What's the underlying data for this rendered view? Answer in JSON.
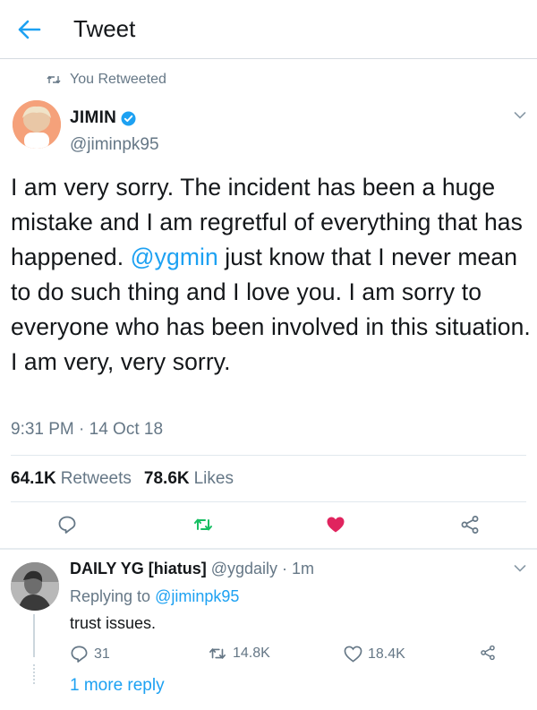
{
  "header": {
    "title": "Tweet",
    "back_icon": "arrow-left-icon"
  },
  "retweet_context": {
    "label": "You Retweeted",
    "icon": "retweet-icon"
  },
  "tweet": {
    "author": {
      "display_name": "JIMIN",
      "handle": "@jiminpk95",
      "verified": true
    },
    "text_segments": [
      "I am very sorry. The incident has been a huge mistake and I am regretful of everything that has happened. ",
      "@ygmin",
      " just know that I never mean to do such thing and I love you. I am sorry to everyone who has been involved in this situation. I am very, very sorry."
    ],
    "timestamp": "9:31 PM · 14 Oct 18",
    "stats": {
      "retweets_count": "64.1K",
      "retweets_label": "Retweets",
      "likes_count": "78.6K",
      "likes_label": "Likes"
    },
    "actions": [
      "reply-icon",
      "retweet-icon",
      "heart-icon",
      "share-icon"
    ]
  },
  "reply": {
    "display_name": "DAILY YG [hiatus]",
    "handle": "@ygdaily",
    "time": "· 1m",
    "replying_prefix": "Replying to",
    "replying_to": "@jiminpk95",
    "text": "trust issues.",
    "reply_count": "31",
    "retweet_count": "14.8K",
    "like_count": "18.4K",
    "more_replies": "1 more reply"
  },
  "colors": {
    "accent": "#1da1f2",
    "retweet_green": "#17bf63",
    "like_red": "#e0245e",
    "secondary_text": "#657786"
  }
}
